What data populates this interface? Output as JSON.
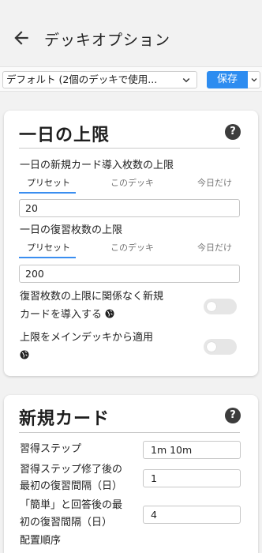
{
  "header": {
    "title": "デッキオプション",
    "back_icon": "arrow-left-icon"
  },
  "toolbar": {
    "preset_value": "デフォルト (2個のデッキで使用...",
    "save_label": "保存",
    "accent_color": "#2d8cf0"
  },
  "daily_limits": {
    "title": "一日の上限",
    "new_cards_label": "一日の新規カード導入枚数の上限",
    "new_tabs": [
      "プリセット",
      "このデッキ",
      "今日だけ"
    ],
    "new_value": "20",
    "review_label": "一日の復習枚数の上限",
    "review_tabs": [
      "プリセット",
      "このデッキ",
      "今日だけ"
    ],
    "review_value": "200",
    "new_ignore_review_line1": "復習枚数の上限に関係なく新規",
    "new_ignore_review_line2": "カードを導入する",
    "apply_from_top_line1": "上限をメインデッキから適用",
    "new_ignore_review_on": false,
    "apply_from_top_on": false
  },
  "new_cards": {
    "title": "新規カード",
    "learning_steps_label": "習得ステップ",
    "learning_steps_value": "1m 10m",
    "graduating_interval_line1": "習得ステップ修了後の",
    "graduating_interval_line2": "最初の復習間隔（日）",
    "graduating_interval_value": "1",
    "easy_interval_line1": "「簡単」と回答後の最",
    "easy_interval_line2": "初の復習間隔（日）",
    "easy_interval_value": "4",
    "insertion_order_label": "配置順序"
  }
}
